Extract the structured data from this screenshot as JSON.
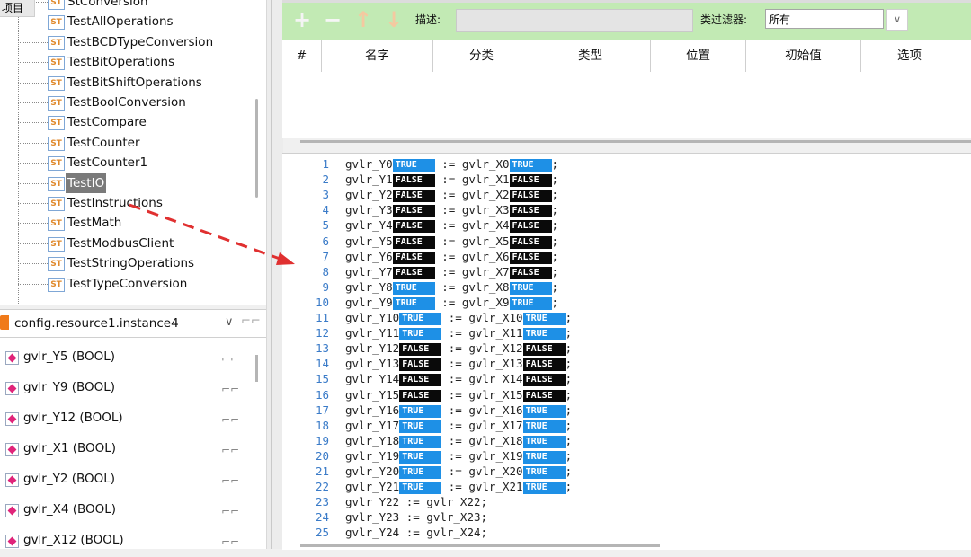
{
  "project": {
    "header": "项目",
    "items": [
      {
        "icon": "ST",
        "label": "StConversion",
        "selected": false
      },
      {
        "icon": "ST",
        "label": "TestAllOperations",
        "selected": false
      },
      {
        "icon": "ST",
        "label": "TestBCDTypeConversion",
        "selected": false
      },
      {
        "icon": "ST",
        "label": "TestBitOperations",
        "selected": false
      },
      {
        "icon": "ST",
        "label": "TestBitShiftOperations",
        "selected": false
      },
      {
        "icon": "ST",
        "label": "TestBoolConversion",
        "selected": false
      },
      {
        "icon": "ST",
        "label": "TestCompare",
        "selected": false
      },
      {
        "icon": "ST",
        "label": "TestCounter",
        "selected": false
      },
      {
        "icon": "ST",
        "label": "TestCounter1",
        "selected": false
      },
      {
        "icon": "ST",
        "label": "TestIO",
        "selected": true
      },
      {
        "icon": "ST",
        "label": "TestInstructions",
        "selected": false
      },
      {
        "icon": "ST",
        "label": "TestMath",
        "selected": false
      },
      {
        "icon": "ST",
        "label": "TestModbusClient",
        "selected": false
      },
      {
        "icon": "ST",
        "label": "TestStringOperations",
        "selected": false
      },
      {
        "icon": "ST",
        "label": "TestTypeConversion",
        "selected": false
      }
    ]
  },
  "instance": {
    "label": "config.resource1.instance4",
    "chevron": "∨",
    "glasses": "⌐⌐"
  },
  "variables": [
    {
      "label": "gvlr_Y5 (BOOL)",
      "glasses": "⌐⌐"
    },
    {
      "label": "gvlr_Y9 (BOOL)",
      "glasses": "⌐⌐"
    },
    {
      "label": "gvlr_Y12 (BOOL)",
      "glasses": "⌐⌐"
    },
    {
      "label": "gvlr_X1 (BOOL)",
      "glasses": "⌐⌐"
    },
    {
      "label": "gvlr_Y2 (BOOL)",
      "glasses": "⌐⌐"
    },
    {
      "label": "gvlr_X4 (BOOL)",
      "glasses": "⌐⌐"
    },
    {
      "label": "gvlr_X12 (BOOL)",
      "glasses": "⌐⌐"
    }
  ],
  "toolbar": {
    "add": "+",
    "remove": "−",
    "up": "↑",
    "down": "↓",
    "desc_label": "描述:",
    "desc_value": "",
    "filter_label": "类过滤器:",
    "filter_value": "所有",
    "filter_chevron": "∨"
  },
  "grid": {
    "columns": [
      "#",
      "名字",
      "分类",
      "类型",
      "位置",
      "初始值",
      "选项"
    ]
  },
  "code": {
    "watch_lines": [
      {
        "n": "1",
        "lhs": "gvlr_Y0",
        "lv": "TRUE",
        "rhs": "gvlr_X0",
        "rv": "TRUE"
      },
      {
        "n": "2",
        "lhs": "gvlr_Y1",
        "lv": "FALSE",
        "rhs": "gvlr_X1",
        "rv": "FALSE"
      },
      {
        "n": "3",
        "lhs": "gvlr_Y2",
        "lv": "FALSE",
        "rhs": "gvlr_X2",
        "rv": "FALSE"
      },
      {
        "n": "4",
        "lhs": "gvlr_Y3",
        "lv": "FALSE",
        "rhs": "gvlr_X3",
        "rv": "FALSE"
      },
      {
        "n": "5",
        "lhs": "gvlr_Y4",
        "lv": "FALSE",
        "rhs": "gvlr_X4",
        "rv": "FALSE"
      },
      {
        "n": "6",
        "lhs": "gvlr_Y5",
        "lv": "FALSE",
        "rhs": "gvlr_X5",
        "rv": "FALSE"
      },
      {
        "n": "7",
        "lhs": "gvlr_Y6",
        "lv": "FALSE",
        "rhs": "gvlr_X6",
        "rv": "FALSE"
      },
      {
        "n": "8",
        "lhs": "gvlr_Y7",
        "lv": "FALSE",
        "rhs": "gvlr_X7",
        "rv": "FALSE"
      },
      {
        "n": "9",
        "lhs": "gvlr_Y8",
        "lv": "TRUE",
        "rhs": "gvlr_X8",
        "rv": "TRUE"
      },
      {
        "n": "10",
        "lhs": "gvlr_Y9",
        "lv": "TRUE",
        "rhs": "gvlr_X9",
        "rv": "TRUE"
      },
      {
        "n": "11",
        "lhs": "gvlr_Y10",
        "lv": "TRUE",
        "rhs": "gvlr_X10",
        "rv": "TRUE"
      },
      {
        "n": "12",
        "lhs": "gvlr_Y11",
        "lv": "TRUE",
        "rhs": "gvlr_X11",
        "rv": "TRUE"
      },
      {
        "n": "13",
        "lhs": "gvlr_Y12",
        "lv": "FALSE",
        "rhs": "gvlr_X12",
        "rv": "FALSE"
      },
      {
        "n": "14",
        "lhs": "gvlr_Y13",
        "lv": "FALSE",
        "rhs": "gvlr_X13",
        "rv": "FALSE"
      },
      {
        "n": "15",
        "lhs": "gvlr_Y14",
        "lv": "FALSE",
        "rhs": "gvlr_X14",
        "rv": "FALSE"
      },
      {
        "n": "16",
        "lhs": "gvlr_Y15",
        "lv": "FALSE",
        "rhs": "gvlr_X15",
        "rv": "FALSE"
      },
      {
        "n": "17",
        "lhs": "gvlr_Y16",
        "lv": "TRUE",
        "rhs": "gvlr_X16",
        "rv": "TRUE"
      },
      {
        "n": "18",
        "lhs": "gvlr_Y17",
        "lv": "TRUE",
        "rhs": "gvlr_X17",
        "rv": "TRUE"
      },
      {
        "n": "19",
        "lhs": "gvlr_Y18",
        "lv": "TRUE",
        "rhs": "gvlr_X18",
        "rv": "TRUE"
      },
      {
        "n": "20",
        "lhs": "gvlr_Y19",
        "lv": "TRUE",
        "rhs": "gvlr_X19",
        "rv": "TRUE"
      },
      {
        "n": "21",
        "lhs": "gvlr_Y20",
        "lv": "TRUE",
        "rhs": "gvlr_X20",
        "rv": "TRUE"
      },
      {
        "n": "22",
        "lhs": "gvlr_Y21",
        "lv": "TRUE",
        "rhs": "gvlr_X21",
        "rv": "TRUE"
      }
    ],
    "plain_lines": [
      {
        "n": "23",
        "text": "gvlr_Y22 := gvlr_X22;"
      },
      {
        "n": "24",
        "text": "gvlr_Y23 := gvlr_X23;"
      },
      {
        "n": "25",
        "text": "gvlr_Y24 := gvlr_X24;"
      }
    ],
    "assign_op": ":=",
    "terminator": ";"
  },
  "colors": {
    "toolbar_bg": "#c2eab4",
    "true_badge": "#1e90e6",
    "false_badge": "#0a0a0a",
    "annotation_arrow": "#e03030",
    "line_number": "#3a7bc8"
  }
}
